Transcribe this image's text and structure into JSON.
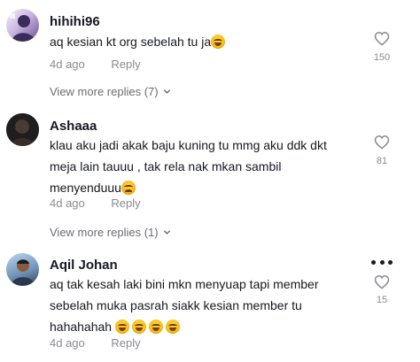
{
  "comments": [
    {
      "username": "hihihi96",
      "text": "aq kesian kt org sebelah tu ja",
      "emojis": [
        "laughing-tears"
      ],
      "time": "4d ago",
      "reply_label": "Reply",
      "like_count": "150",
      "view_more": "View more replies (7)"
    },
    {
      "username": "Ashaaa",
      "text_lines": [
        "klau aku jadi akak baju kuning tu mmg aku ddk dkt",
        "meja lain tauuu , tak rela nak mkan sambil",
        "menyenduuu"
      ],
      "emojis": [
        "crying-face"
      ],
      "time": "4d ago",
      "reply_label": "Reply",
      "like_count": "81",
      "view_more": "View more replies (1)"
    },
    {
      "username": "Aqil Johan",
      "text_lines": [
        "aq tak kesah laki bini mkn menyuap tapi member",
        "sebelah muka pasrah siakk kesian member tu",
        "hahahahah"
      ],
      "emojis": [
        "laughing-tears",
        "laughing-tears",
        "laughing-tears",
        "laughing-tears"
      ],
      "time": "4d ago",
      "reply_label": "Reply",
      "like_count": "15"
    }
  ],
  "colors": {
    "text": "#161823",
    "muted": "#8a8b91",
    "secondary": "#6b6c72"
  }
}
